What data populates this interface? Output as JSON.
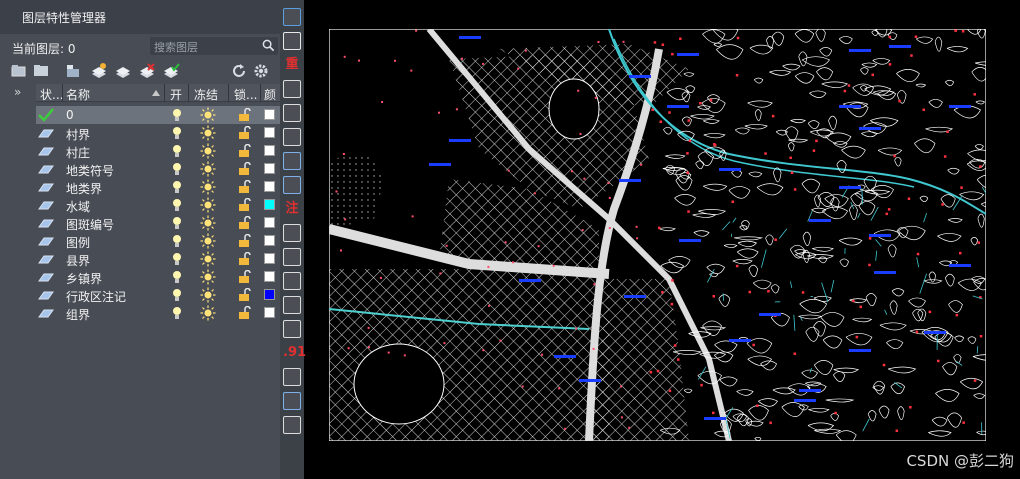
{
  "panel": {
    "title": "图层特性管理器",
    "current_layer_label": "当前图层: 0",
    "search_placeholder": "搜索图层"
  },
  "columns": {
    "collapse": "»",
    "status": "状...",
    "name": "名称",
    "on": "开",
    "freeze": "冻结",
    "lock": "锁...",
    "color": "颜"
  },
  "layers": [
    {
      "name": "0",
      "current": true,
      "color": "#ffffff"
    },
    {
      "name": "村界",
      "color": "#ffffff"
    },
    {
      "name": "村庄",
      "color": "#ffffff"
    },
    {
      "name": "地类符号",
      "color": "#ffffff"
    },
    {
      "name": "地类界",
      "color": "#ffffff"
    },
    {
      "name": "水域",
      "color": "#00ffff"
    },
    {
      "name": "图斑编号",
      "color": "#ffffff"
    },
    {
      "name": "图例",
      "color": "#ffffff"
    },
    {
      "name": "县界",
      "color": "#ffffff"
    },
    {
      "name": "乡镇界",
      "color": "#ffffff"
    },
    {
      "name": "行政区注记",
      "color": "#0000ff"
    },
    {
      "name": "组界",
      "color": "#ffffff"
    }
  ],
  "strip_icons": [
    "code-icon",
    "check-list-icon",
    "重",
    "scatter-icon",
    "camera-icon",
    "ruler-icon",
    "image-icon",
    "image-swap-icon",
    "注",
    "frame-icon",
    "rect-icon",
    "table-icon",
    "table2-icon",
    "hatch-icon",
    ".91",
    "circle-icon",
    "pencil-icon",
    "wave-icon"
  ],
  "canvas": {
    "bg": "#000000",
    "drawing_bg": "#000000"
  },
  "watermark": "CSDN @彭二狗"
}
